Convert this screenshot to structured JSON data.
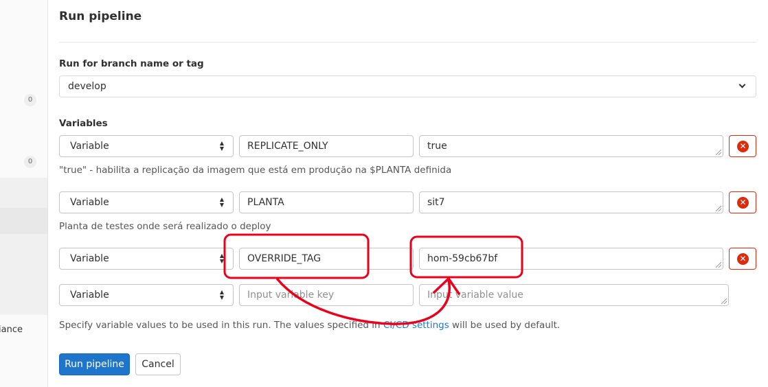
{
  "sidebar": {
    "badges": [
      "0",
      "0"
    ],
    "truncated_item": "iance"
  },
  "page": {
    "title": "Run pipeline"
  },
  "branch": {
    "label": "Run for branch name or tag",
    "value": "develop"
  },
  "variables": {
    "label": "Variables",
    "rows": [
      {
        "type": "Variable",
        "key": "REPLICATE_ONLY",
        "value": "true",
        "description": "\"true\" - habilita a replicação da imagem que está em produção na $PLANTA definida"
      },
      {
        "type": "Variable",
        "key": "PLANTA",
        "value": "sit7",
        "description": "Planta de testes onde será realizado o deploy"
      },
      {
        "type": "Variable",
        "key": "OVERRIDE_TAG",
        "value": "hom-59cb67bf",
        "description": ""
      },
      {
        "type": "Variable",
        "key_placeholder": "Input variable key",
        "value_placeholder": "Input variable value"
      }
    ]
  },
  "help": {
    "before": "Specify variable values to be used in this run. The values specified in ",
    "link": "CI/CD settings",
    "after": " will be used by default."
  },
  "buttons": {
    "run": "Run pipeline",
    "cancel": "Cancel"
  },
  "colors": {
    "primary": "#1f75cb",
    "danger": "#dd2b0e",
    "annotation": "#e8001c"
  },
  "icons": {
    "branch_dropdown": "chevron-down-icon",
    "type_select": "sort-updown-icon",
    "remove": "close-circle-icon"
  }
}
